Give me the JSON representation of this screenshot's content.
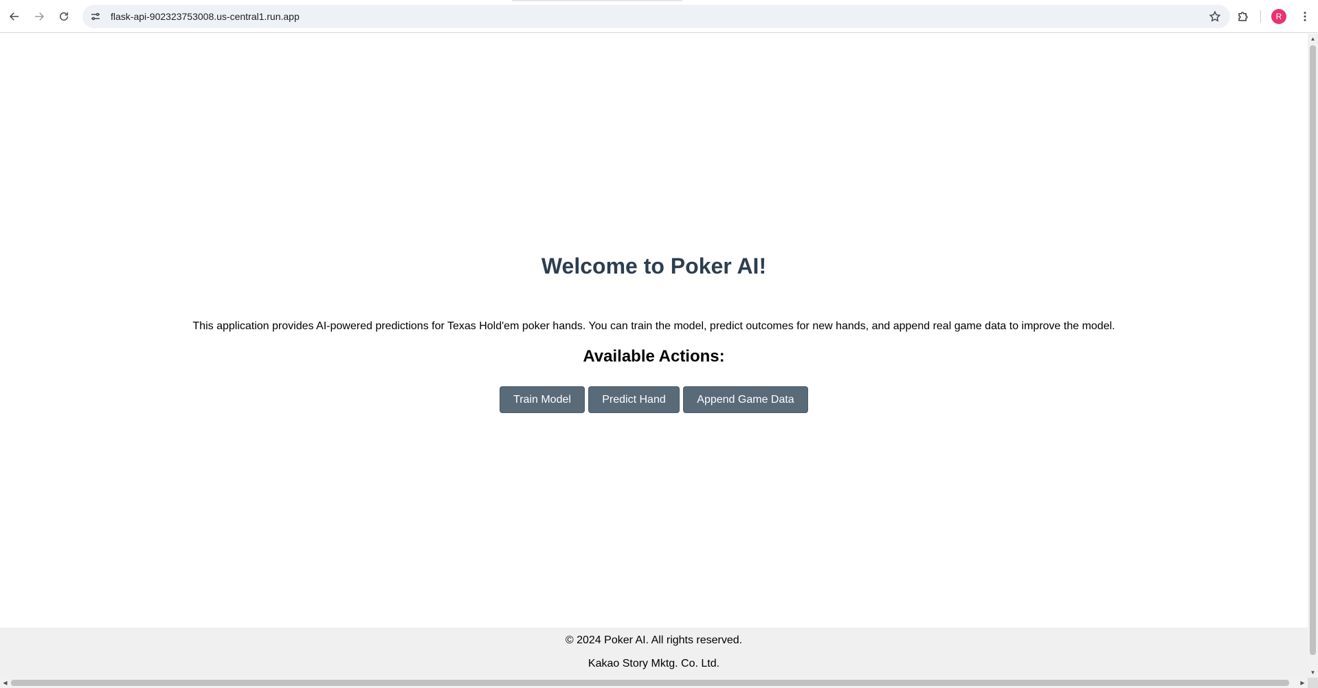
{
  "browser": {
    "url": "flask-api-902323753008.us-central1.run.app",
    "avatar_initial": "R",
    "icons": {
      "back": "back-arrow-icon",
      "forward": "forward-arrow-icon",
      "reload": "reload-icon",
      "site_info": "tune-icon",
      "bookmark": "star-icon",
      "extensions": "puzzle-icon",
      "menu": "kebab-menu-icon"
    }
  },
  "page": {
    "title": "Welcome to Poker AI!",
    "description": "This application provides AI-powered predictions for Texas Hold'em poker hands. You can train the model, predict outcomes for new hands, and append real game data to improve the model.",
    "actions_heading": "Available Actions:",
    "buttons": {
      "train": "Train Model",
      "predict": "Predict Hand",
      "append": "Append Game Data"
    },
    "button_color": "#596a79",
    "title_color": "#2c3e50"
  },
  "footer": {
    "copyright": "© 2024 Poker AI. All rights reserved.",
    "company": "Kakao Story Mktg. Co. Ltd.",
    "background": "#f0f0f0"
  }
}
